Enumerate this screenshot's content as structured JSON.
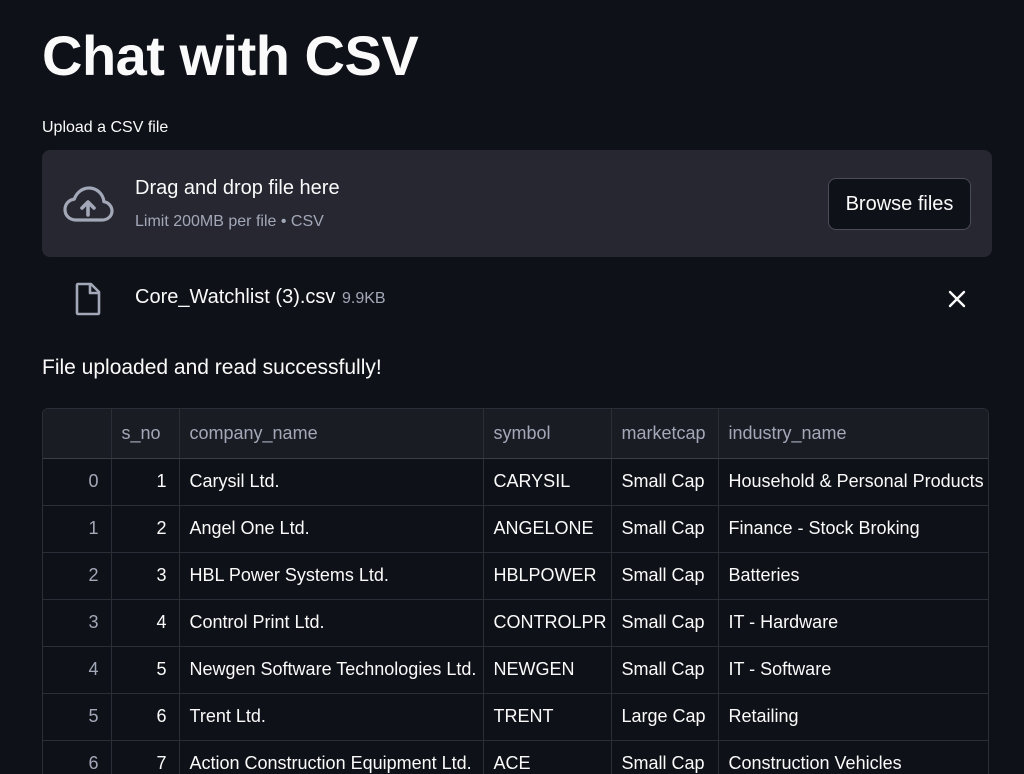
{
  "page": {
    "title": "Chat with CSV"
  },
  "uploader": {
    "label": "Upload a CSV file",
    "drop_title": "Drag and drop file here",
    "drop_subtitle": "Limit 200MB per file • CSV",
    "browse_label": "Browse files"
  },
  "file": {
    "name": "Core_Watchlist (3).csv",
    "size": "9.9KB"
  },
  "status": {
    "message": "File uploaded and read successfully!"
  },
  "table": {
    "columns": [
      "",
      "s_no",
      "company_name",
      "symbol",
      "marketcap",
      "industry_name"
    ],
    "rows": [
      [
        "0",
        "1",
        "Carysil Ltd.",
        "CARYSIL",
        "Small Cap",
        "Household & Personal Products"
      ],
      [
        "1",
        "2",
        "Angel One Ltd.",
        "ANGELONE",
        "Small Cap",
        "Finance - Stock Broking"
      ],
      [
        "2",
        "3",
        "HBL Power Systems Ltd.",
        "HBLPOWER",
        "Small Cap",
        "Batteries"
      ],
      [
        "3",
        "4",
        "Control Print Ltd.",
        "CONTROLPR",
        "Small Cap",
        "IT - Hardware"
      ],
      [
        "4",
        "5",
        "Newgen Software Technologies Ltd.",
        "NEWGEN",
        "Small Cap",
        "IT - Software"
      ],
      [
        "5",
        "6",
        "Trent Ltd.",
        "TRENT",
        "Large Cap",
        "Retailing"
      ],
      [
        "6",
        "7",
        "Action Construction Equipment Ltd.",
        "ACE",
        "Small Cap",
        "Construction Vehicles"
      ]
    ]
  },
  "icons": {
    "upload": "cloud-upload-icon",
    "file": "file-icon",
    "remove": "close-icon"
  }
}
